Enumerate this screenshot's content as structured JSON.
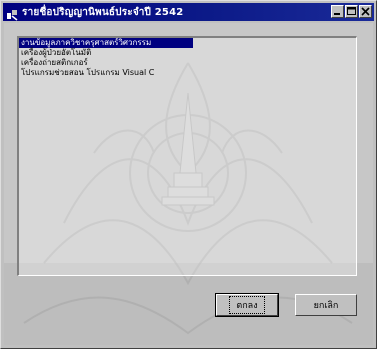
{
  "window": {
    "title": "รายชื่อปริญญานิพนธ์ประจำปี 2542"
  },
  "list": {
    "items": [
      {
        "label": "งานข้อมูลภาควิชาครุศาสตร์วิศวกรรม",
        "selected": true
      },
      {
        "label": "เครื่องผู้ป่วยอัตโนมัติ",
        "selected": false
      },
      {
        "label": "เครื่องถ่ายสติกเกอร์",
        "selected": false
      },
      {
        "label": "โปรแกรมช่วยสอน โปรแกรม Visual C",
        "selected": false
      }
    ]
  },
  "buttons": {
    "ok_label": "ตกลง",
    "cancel_label": "ยกเลิก"
  },
  "colors": {
    "titlebar": "#000080",
    "selection": "#000080",
    "face": "#c0c0c0"
  },
  "icons": {
    "app": "app-icon",
    "minimize": "minimize-icon",
    "maximize": "maximize-icon",
    "close": "close-icon"
  }
}
